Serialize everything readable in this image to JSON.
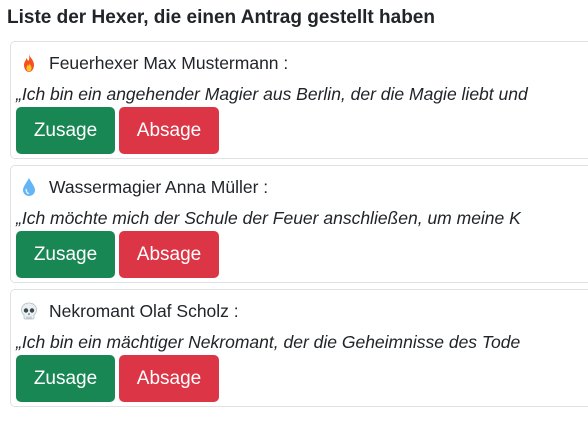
{
  "page": {
    "title": "Liste der Hexer, die einen Antrag gestellt haben"
  },
  "applications": [
    {
      "icon": "fire-icon",
      "name": "Feuerhexer Max Mustermann :",
      "quote": "„Ich bin ein angehender Magier aus Berlin, der die Magie liebt und",
      "accept_label": "Zusage",
      "reject_label": "Absage"
    },
    {
      "icon": "water-drop-icon",
      "name": "Wassermagier Anna Müller :",
      "quote": "„Ich möchte mich der Schule der Feuer anschließen, um meine K",
      "accept_label": "Zusage",
      "reject_label": "Absage"
    },
    {
      "icon": "skull-icon",
      "name": "Nekromant Olaf Scholz :",
      "quote": "„Ich bin ein mächtiger Nekromant, der die Geheimnisse des Tode",
      "accept_label": "Zusage",
      "reject_label": "Absage"
    }
  ],
  "colors": {
    "accept": "#198754",
    "reject": "#dc3545",
    "card_border": "#dfe2e5",
    "text": "#212529"
  }
}
